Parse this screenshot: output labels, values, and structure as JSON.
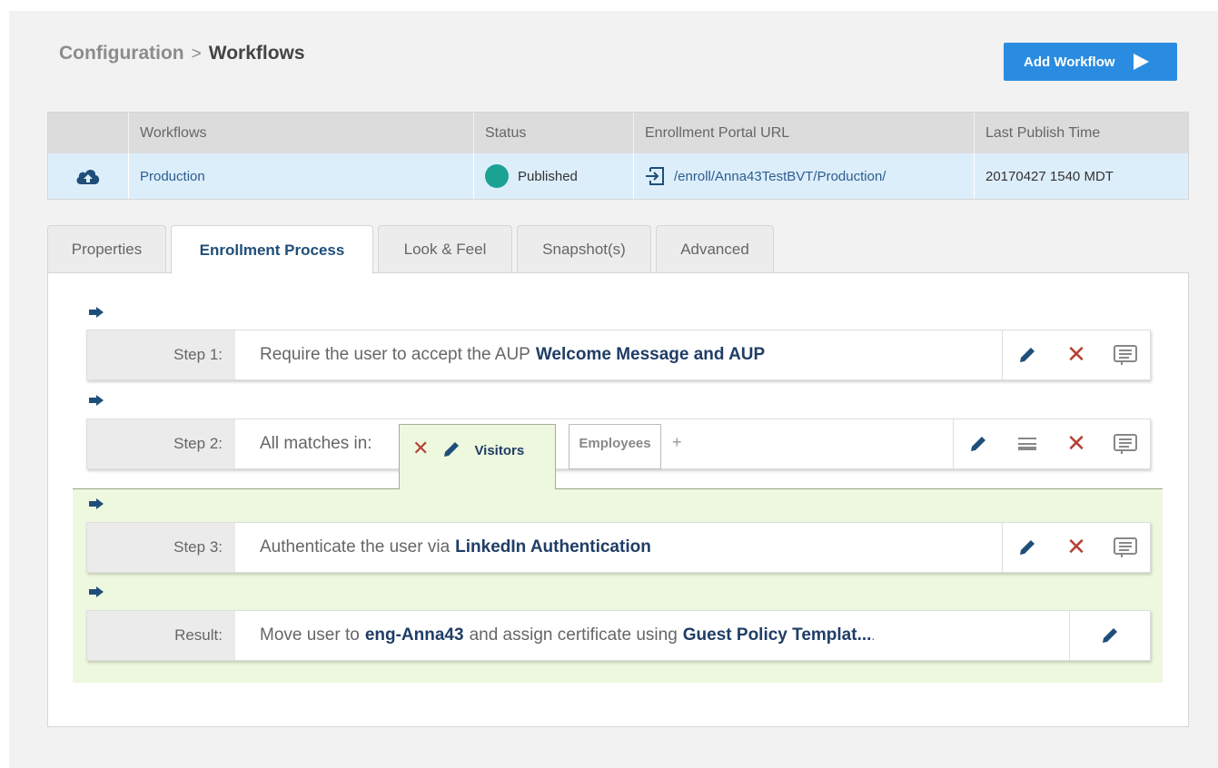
{
  "breadcrumb": {
    "parent": "Configuration",
    "separator": ">",
    "current": "Workflows"
  },
  "add_button": {
    "label": "Add Workflow"
  },
  "table": {
    "headers": [
      "Workflows",
      "Status",
      "Enrollment Portal URL",
      "Last Publish Time"
    ],
    "row": {
      "name": "Production",
      "status": "Published",
      "url": "/enroll/Anna43TestBVT/Production/",
      "last_publish": "20170427 1540 MDT"
    },
    "status_color": "#1aa392"
  },
  "tabs": [
    {
      "label": "Properties",
      "active": false
    },
    {
      "label": "Enrollment Process",
      "active": true
    },
    {
      "label": "Look & Feel",
      "active": false
    },
    {
      "label": "Snapshot(s)",
      "active": false
    },
    {
      "label": "Advanced",
      "active": false
    }
  ],
  "steps": {
    "step1": {
      "label": "Step 1:",
      "text": "Require the user to accept the AUP",
      "bold": "Welcome Message and AUP"
    },
    "step2": {
      "label": "Step 2:",
      "text": "All matches in:",
      "active_condition": "Visitors",
      "other_condition": "Employees",
      "add": "+"
    },
    "step3": {
      "label": "Step 3:",
      "text": "Authenticate the user via",
      "bold": "LinkedIn Authentication"
    },
    "result": {
      "label": "Result:",
      "text1": "Move user to",
      "bold1": "eng-Anna43",
      "text2": "and assign certificate using",
      "bold2": "Guest Policy Templat...",
      "dot": "."
    }
  },
  "colors": {
    "accent": "#2a8ce0",
    "dark_blue": "#1f4e79",
    "delete": "#b54033",
    "condition_bg": "#eef8de"
  }
}
